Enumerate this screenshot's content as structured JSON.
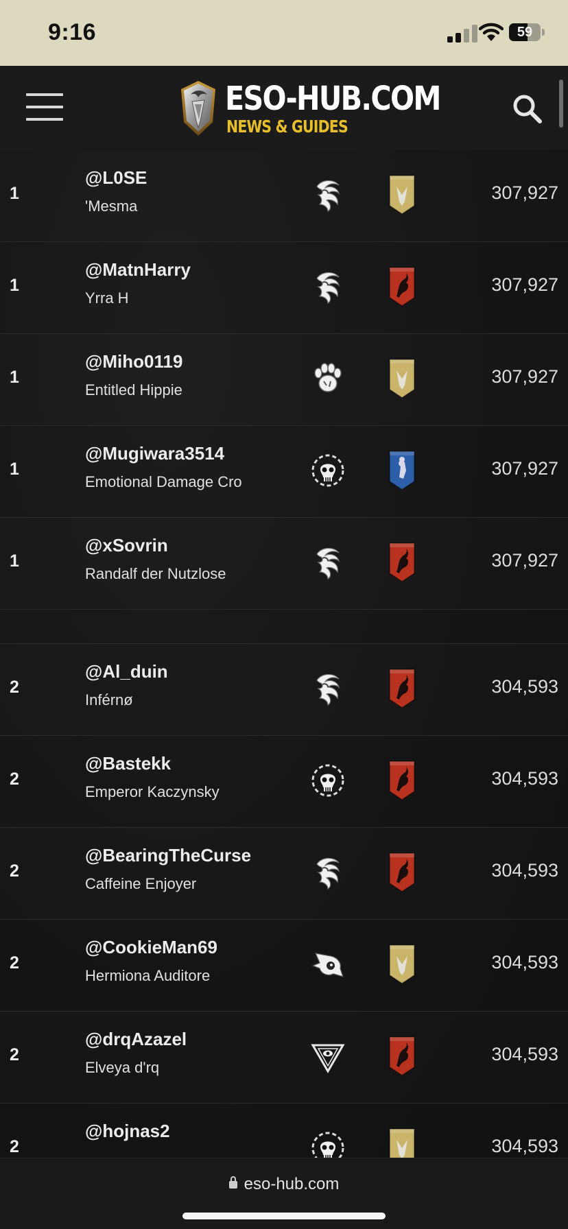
{
  "status_bar": {
    "time": "9:16",
    "battery_percent": "59",
    "battery_level": 0.59
  },
  "header": {
    "logo_title": "ESO-HUB.COM",
    "logo_subtitle": "NEWS & GUIDES",
    "menu_icon": "hamburger-icon",
    "search_icon": "search-icon"
  },
  "leaderboard": {
    "group_1": [
      {
        "rank": "1",
        "account": "@L0SE",
        "character": "'Mesma",
        "class_icon": "sorcerer-icon",
        "alliance": "aldmeri-dominion",
        "score": "307,927"
      },
      {
        "rank": "1",
        "account": "@MatnHarry",
        "character": "Yrra H",
        "class_icon": "sorcerer-icon",
        "alliance": "ebonheart-pact",
        "score": "307,927"
      },
      {
        "rank": "1",
        "account": "@Miho0119",
        "character": "Entitled Hippie",
        "class_icon": "warden-icon",
        "alliance": "aldmeri-dominion",
        "score": "307,927"
      },
      {
        "rank": "1",
        "account": "@Mugiwara3514",
        "character": "Emotional Damage Cro",
        "class_icon": "necromancer-icon",
        "alliance": "daggerfall-covenant",
        "score": "307,927"
      },
      {
        "rank": "1",
        "account": "@xSovrin",
        "character": "Randalf der Nutzlose",
        "class_icon": "sorcerer-icon",
        "alliance": "ebonheart-pact",
        "score": "307,927"
      }
    ],
    "group_2": [
      {
        "rank": "2",
        "account": "@Al_duin",
        "character": "Inférnø",
        "class_icon": "sorcerer-icon",
        "alliance": "ebonheart-pact",
        "score": "304,593"
      },
      {
        "rank": "2",
        "account": "@Bastekk",
        "character": "Emperor Kaczynsky",
        "class_icon": "necromancer-icon",
        "alliance": "ebonheart-pact",
        "score": "304,593"
      },
      {
        "rank": "2",
        "account": "@BearingTheCurse",
        "character": "Caffeine Enjoyer",
        "class_icon": "sorcerer-icon",
        "alliance": "ebonheart-pact",
        "score": "304,593"
      },
      {
        "rank": "2",
        "account": "@CookieMan69",
        "character": "Hermiona Auditore",
        "class_icon": "nightblade-icon",
        "alliance": "aldmeri-dominion",
        "score": "304,593"
      },
      {
        "rank": "2",
        "account": "@drqAzazel",
        "character": "Elveya d'rq",
        "class_icon": "arcanist-icon",
        "alliance": "ebonheart-pact",
        "score": "304,593"
      },
      {
        "rank": "2",
        "account": "@hojnas2",
        "character": "",
        "class_icon": "necromancer-icon",
        "alliance": "aldmeri-dominion",
        "score": "304,593"
      }
    ]
  },
  "colors": {
    "aldmeri-dominion": "#c9b46a",
    "ebonheart-pact": "#b8321f",
    "daggerfall-covenant": "#2d5ea8",
    "accent_gold": "#e8bf2a"
  },
  "url_bar": {
    "url": "eso-hub.com",
    "lock_icon": "lock-icon"
  }
}
